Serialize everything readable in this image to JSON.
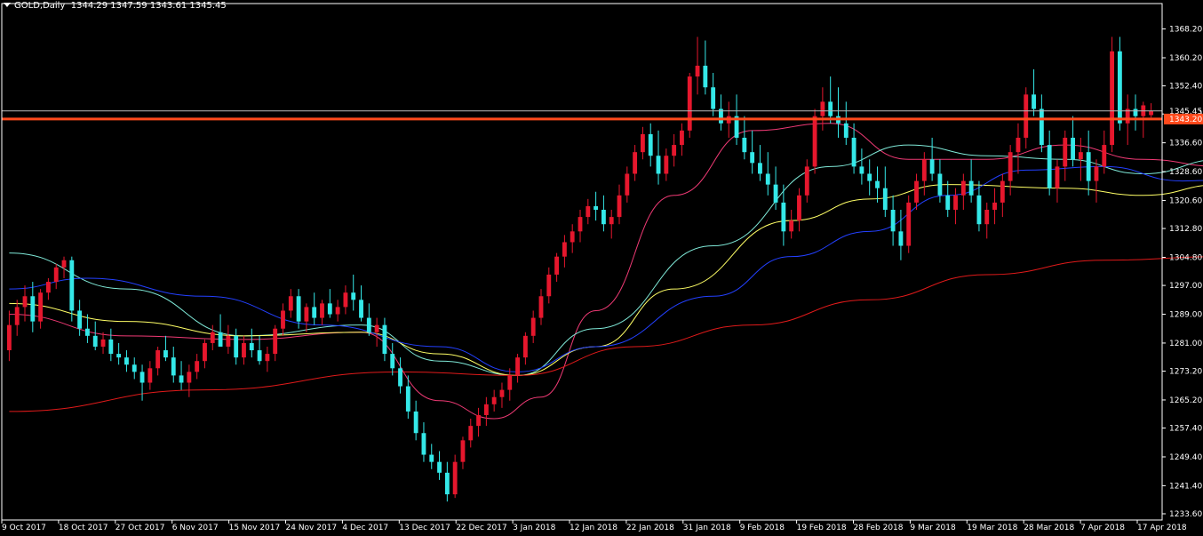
{
  "header": {
    "symbol": "GOLD,Daily",
    "open": "1344.29",
    "high": "1347.59",
    "low": "1343.61",
    "close": "1345.45"
  },
  "colors": {
    "background": "#000000",
    "axis": "#ffffff",
    "bull": "#e6172d",
    "bear": "#34e8e8",
    "ma_fast": "#f03a75",
    "ma_cyan": "#7fe9d8",
    "ma_yellow": "#ffff66",
    "ma_blue": "#2340ff",
    "ma_long": "#e01a1a",
    "price_line": "#ff4a1c",
    "bid_line": "#b8b8b8"
  },
  "chart_data": {
    "type": "candlestick",
    "title": "GOLD,Daily",
    "ylim": [
      1233.6,
      1371.8
    ],
    "y_ticks": [
      "1368.20",
      "1360.20",
      "1352.40",
      "1344.60",
      "1336.60",
      "1328.60",
      "1320.60",
      "1312.80",
      "1304.80",
      "1297.00",
      "1289.00",
      "1281.00",
      "1273.20",
      "1265.20",
      "1257.40",
      "1249.40",
      "1241.40",
      "1233.60"
    ],
    "x_ticks": [
      "9 Oct 2017",
      "18 Oct 2017",
      "27 Oct 2017",
      "6 Nov 2017",
      "15 Nov 2017",
      "24 Nov 2017",
      "4 Dec 2017",
      "13 Dec 2017",
      "22 Dec 2017",
      "3 Jan 2018",
      "12 Jan 2018",
      "22 Jan 2018",
      "31 Jan 2018",
      "9 Feb 2018",
      "19 Feb 2018",
      "28 Feb 2018",
      "9 Mar 2018",
      "19 Mar 2018",
      "28 Mar 2018",
      "7 Apr 2018",
      "17 Apr 2018"
    ],
    "current_price": "1345.45",
    "price_line_value": "1343.20",
    "bid_line_value": 1345.45,
    "ohlc": [
      [
        1279,
        1290,
        1276,
        1286
      ],
      [
        1286,
        1293,
        1283,
        1291
      ],
      [
        1291,
        1297,
        1287,
        1294
      ],
      [
        1294,
        1298,
        1284,
        1287
      ],
      [
        1287,
        1296,
        1285,
        1295
      ],
      [
        1295,
        1299,
        1293,
        1298
      ],
      [
        1298,
        1303,
        1296,
        1302
      ],
      [
        1302,
        1305,
        1299,
        1304
      ],
      [
        1304,
        1305,
        1287,
        1290
      ],
      [
        1290,
        1293,
        1283,
        1285
      ],
      [
        1285,
        1289,
        1281,
        1283
      ],
      [
        1283,
        1287,
        1279,
        1280
      ],
      [
        1280,
        1284,
        1278,
        1282
      ],
      [
        1282,
        1285,
        1276,
        1278
      ],
      [
        1278,
        1281,
        1275,
        1277
      ],
      [
        1277,
        1279,
        1273,
        1275
      ],
      [
        1275,
        1277,
        1271,
        1273
      ],
      [
        1273,
        1275,
        1265,
        1270
      ],
      [
        1270,
        1276,
        1268,
        1274
      ],
      [
        1274,
        1280,
        1272,
        1279
      ],
      [
        1279,
        1283,
        1276,
        1277
      ],
      [
        1277,
        1280,
        1270,
        1272
      ],
      [
        1272,
        1276,
        1268,
        1270
      ],
      [
        1270,
        1275,
        1266,
        1273
      ],
      [
        1273,
        1278,
        1271,
        1276
      ],
      [
        1276,
        1282,
        1274,
        1281
      ],
      [
        1281,
        1286,
        1279,
        1284
      ],
      [
        1284,
        1289,
        1282,
        1280
      ],
      [
        1280,
        1286,
        1278,
        1283
      ],
      [
        1283,
        1285,
        1275,
        1277
      ],
      [
        1277,
        1283,
        1275,
        1281
      ],
      [
        1281,
        1285,
        1277,
        1279
      ],
      [
        1279,
        1283,
        1275,
        1276
      ],
      [
        1276,
        1280,
        1273,
        1278
      ],
      [
        1278,
        1286,
        1276,
        1285
      ],
      [
        1285,
        1292,
        1283,
        1290
      ],
      [
        1290,
        1296,
        1288,
        1294
      ],
      [
        1294,
        1296,
        1285,
        1287
      ],
      [
        1287,
        1292,
        1284,
        1291
      ],
      [
        1291,
        1295,
        1286,
        1288
      ],
      [
        1288,
        1293,
        1286,
        1292
      ],
      [
        1292,
        1296,
        1288,
        1289
      ],
      [
        1289,
        1293,
        1287,
        1291
      ],
      [
        1291,
        1297,
        1289,
        1295
      ],
      [
        1295,
        1300,
        1290,
        1293
      ],
      [
        1293,
        1297,
        1287,
        1288
      ],
      [
        1288,
        1292,
        1283,
        1284
      ],
      [
        1284,
        1288,
        1280,
        1286
      ],
      [
        1286,
        1288,
        1276,
        1278
      ],
      [
        1278,
        1281,
        1272,
        1274
      ],
      [
        1274,
        1277,
        1267,
        1269
      ],
      [
        1269,
        1272,
        1260,
        1262
      ],
      [
        1262,
        1265,
        1254,
        1256
      ],
      [
        1256,
        1259,
        1248,
        1250
      ],
      [
        1250,
        1253,
        1246,
        1248
      ],
      [
        1248,
        1251,
        1243,
        1245
      ],
      [
        1245,
        1248,
        1237,
        1239
      ],
      [
        1239,
        1250,
        1238,
        1248
      ],
      [
        1248,
        1255,
        1246,
        1254
      ],
      [
        1254,
        1260,
        1252,
        1258
      ],
      [
        1258,
        1263,
        1255,
        1261
      ],
      [
        1261,
        1266,
        1258,
        1264
      ],
      [
        1264,
        1268,
        1262,
        1266
      ],
      [
        1266,
        1270,
        1263,
        1268
      ],
      [
        1268,
        1274,
        1265,
        1272
      ],
      [
        1272,
        1278,
        1270,
        1277
      ],
      [
        1277,
        1284,
        1275,
        1283
      ],
      [
        1283,
        1290,
        1281,
        1288
      ],
      [
        1288,
        1296,
        1286,
        1294
      ],
      [
        1294,
        1302,
        1292,
        1300
      ],
      [
        1300,
        1306,
        1298,
        1305
      ],
      [
        1305,
        1311,
        1302,
        1309
      ],
      [
        1309,
        1314,
        1306,
        1312
      ],
      [
        1312,
        1318,
        1309,
        1316
      ],
      [
        1316,
        1321,
        1314,
        1319
      ],
      [
        1319,
        1323,
        1315,
        1318
      ],
      [
        1318,
        1322,
        1312,
        1314
      ],
      [
        1314,
        1318,
        1310,
        1316
      ],
      [
        1316,
        1325,
        1314,
        1322
      ],
      [
        1322,
        1330,
        1320,
        1328
      ],
      [
        1328,
        1336,
        1326,
        1334
      ],
      [
        1334,
        1341,
        1332,
        1339
      ],
      [
        1339,
        1342,
        1330,
        1333
      ],
      [
        1333,
        1340,
        1325,
        1328
      ],
      [
        1328,
        1335,
        1326,
        1333
      ],
      [
        1333,
        1339,
        1330,
        1336
      ],
      [
        1336,
        1342,
        1333,
        1340
      ],
      [
        1340,
        1356,
        1338,
        1355
      ],
      [
        1355,
        1366,
        1350,
        1358
      ],
      [
        1358,
        1365,
        1350,
        1352
      ],
      [
        1352,
        1356,
        1344,
        1346
      ],
      [
        1346,
        1350,
        1340,
        1342
      ],
      [
        1342,
        1348,
        1338,
        1344
      ],
      [
        1344,
        1350,
        1336,
        1338
      ],
      [
        1338,
        1344,
        1332,
        1334
      ],
      [
        1334,
        1340,
        1328,
        1331
      ],
      [
        1331,
        1336,
        1326,
        1328
      ],
      [
        1328,
        1334,
        1322,
        1325
      ],
      [
        1325,
        1330,
        1318,
        1320
      ],
      [
        1320,
        1325,
        1308,
        1312
      ],
      [
        1312,
        1318,
        1310,
        1315
      ],
      [
        1315,
        1324,
        1312,
        1322
      ],
      [
        1322,
        1332,
        1320,
        1330
      ],
      [
        1330,
        1346,
        1328,
        1344
      ],
      [
        1344,
        1352,
        1340,
        1348
      ],
      [
        1348,
        1355,
        1342,
        1344
      ],
      [
        1344,
        1352,
        1338,
        1342
      ],
      [
        1342,
        1348,
        1336,
        1338
      ],
      [
        1338,
        1342,
        1328,
        1330
      ],
      [
        1330,
        1335,
        1325,
        1328
      ],
      [
        1328,
        1332,
        1322,
        1326
      ],
      [
        1326,
        1330,
        1320,
        1324
      ],
      [
        1324,
        1330,
        1316,
        1318
      ],
      [
        1318,
        1322,
        1308,
        1312
      ],
      [
        1312,
        1318,
        1304,
        1308
      ],
      [
        1308,
        1322,
        1306,
        1320
      ],
      [
        1320,
        1328,
        1318,
        1326
      ],
      [
        1326,
        1334,
        1322,
        1332
      ],
      [
        1332,
        1338,
        1326,
        1328
      ],
      [
        1328,
        1332,
        1320,
        1322
      ],
      [
        1322,
        1326,
        1316,
        1318
      ],
      [
        1318,
        1324,
        1314,
        1322
      ],
      [
        1322,
        1328,
        1318,
        1326
      ],
      [
        1326,
        1332,
        1320,
        1322
      ],
      [
        1322,
        1326,
        1312,
        1314
      ],
      [
        1314,
        1320,
        1310,
        1318
      ],
      [
        1318,
        1324,
        1314,
        1320
      ],
      [
        1320,
        1328,
        1316,
        1326
      ],
      [
        1326,
        1336,
        1322,
        1334
      ],
      [
        1334,
        1342,
        1328,
        1338
      ],
      [
        1338,
        1352,
        1335,
        1350
      ],
      [
        1350,
        1357,
        1344,
        1346
      ],
      [
        1346,
        1350,
        1334,
        1336
      ],
      [
        1336,
        1340,
        1322,
        1324
      ],
      [
        1324,
        1332,
        1320,
        1330
      ],
      [
        1330,
        1340,
        1326,
        1338
      ],
      [
        1338,
        1344,
        1330,
        1332
      ],
      [
        1332,
        1338,
        1326,
        1334
      ],
      [
        1334,
        1340,
        1322,
        1326
      ],
      [
        1326,
        1332,
        1320,
        1330
      ],
      [
        1330,
        1340,
        1328,
        1336
      ],
      [
        1336,
        1366,
        1334,
        1362
      ],
      [
        1362,
        1366,
        1340,
        1342
      ],
      [
        1342,
        1350,
        1336,
        1346
      ],
      [
        1346,
        1350,
        1340,
        1344
      ],
      [
        1344,
        1348,
        1338,
        1347
      ],
      [
        1344.29,
        1347.59,
        1343.61,
        1345.45
      ]
    ],
    "moving_averages": [
      {
        "name": "ma_fast",
        "color": "#f03a75",
        "values": [
          [
            0,
            1289
          ],
          [
            15,
            1283
          ],
          [
            30,
            1282
          ],
          [
            45,
            1284
          ],
          [
            55,
            1265
          ],
          [
            62,
            1260
          ],
          [
            68,
            1266
          ],
          [
            75,
            1290
          ],
          [
            85,
            1322
          ],
          [
            95,
            1340
          ],
          [
            105,
            1342
          ],
          [
            115,
            1332
          ],
          [
            125,
            1332
          ],
          [
            135,
            1336
          ],
          [
            145,
            1332
          ],
          [
            155,
            1330
          ],
          [
            166,
            1342
          ],
          [
            170,
            1338
          ]
        ]
      },
      {
        "name": "ma_cyan",
        "color": "#7fe9d8",
        "values": [
          [
            0,
            1306
          ],
          [
            15,
            1296
          ],
          [
            30,
            1283
          ],
          [
            45,
            1286
          ],
          [
            55,
            1276
          ],
          [
            65,
            1272
          ],
          [
            75,
            1285
          ],
          [
            90,
            1308
          ],
          [
            105,
            1330
          ],
          [
            115,
            1336
          ],
          [
            125,
            1333
          ],
          [
            135,
            1332
          ],
          [
            145,
            1328
          ],
          [
            155,
            1332
          ],
          [
            166,
            1337
          ],
          [
            170,
            1336
          ]
        ]
      },
      {
        "name": "ma_yellow",
        "color": "#ffff66",
        "values": [
          [
            0,
            1292
          ],
          [
            15,
            1287
          ],
          [
            30,
            1283
          ],
          [
            45,
            1284
          ],
          [
            55,
            1278
          ],
          [
            65,
            1272
          ],
          [
            75,
            1280
          ],
          [
            85,
            1296
          ],
          [
            100,
            1315
          ],
          [
            110,
            1321
          ],
          [
            120,
            1325
          ],
          [
            135,
            1324
          ],
          [
            145,
            1322
          ],
          [
            155,
            1325
          ],
          [
            166,
            1331
          ],
          [
            170,
            1333
          ]
        ]
      },
      {
        "name": "ma_blue",
        "color": "#2340ff",
        "values": [
          [
            0,
            1296
          ],
          [
            10,
            1299
          ],
          [
            25,
            1294
          ],
          [
            40,
            1286
          ],
          [
            55,
            1280
          ],
          [
            65,
            1273
          ],
          [
            75,
            1280
          ],
          [
            90,
            1294
          ],
          [
            100,
            1305
          ],
          [
            110,
            1312
          ],
          [
            120,
            1322
          ],
          [
            130,
            1329
          ],
          [
            140,
            1330
          ],
          [
            150,
            1326
          ],
          [
            160,
            1327
          ],
          [
            170,
            1331
          ]
        ]
      },
      {
        "name": "ma_long",
        "color": "#e01a1a",
        "values": [
          [
            0,
            1262
          ],
          [
            25,
            1268
          ],
          [
            50,
            1273
          ],
          [
            65,
            1272
          ],
          [
            80,
            1280
          ],
          [
            95,
            1286
          ],
          [
            110,
            1293
          ],
          [
            125,
            1300
          ],
          [
            140,
            1304
          ],
          [
            155,
            1305
          ],
          [
            170,
            1308
          ]
        ]
      }
    ]
  }
}
